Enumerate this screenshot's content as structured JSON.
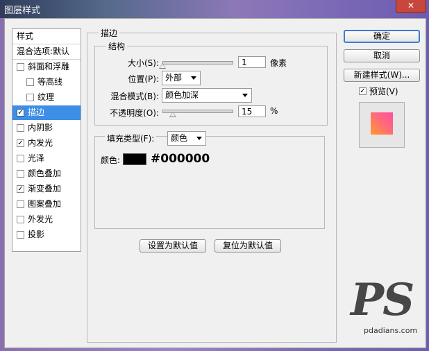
{
  "window": {
    "title": "图层样式",
    "close_glyph": "✕"
  },
  "stylelist": {
    "header": "样式",
    "blending": "混合选项:默认",
    "items": [
      {
        "label": "斜面和浮雕",
        "checked": false,
        "indent": false
      },
      {
        "label": "等高线",
        "checked": false,
        "indent": true
      },
      {
        "label": "纹理",
        "checked": false,
        "indent": true
      },
      {
        "label": "描边",
        "checked": true,
        "indent": false,
        "selected": true
      },
      {
        "label": "内阴影",
        "checked": false,
        "indent": false
      },
      {
        "label": "内发光",
        "checked": true,
        "indent": false
      },
      {
        "label": "光泽",
        "checked": false,
        "indent": false
      },
      {
        "label": "颜色叠加",
        "checked": false,
        "indent": false
      },
      {
        "label": "渐变叠加",
        "checked": true,
        "indent": false
      },
      {
        "label": "图案叠加",
        "checked": false,
        "indent": false
      },
      {
        "label": "外发光",
        "checked": false,
        "indent": false
      },
      {
        "label": "投影",
        "checked": false,
        "indent": false
      }
    ]
  },
  "stroke": {
    "title": "描边",
    "structure": {
      "title": "结构",
      "size_label": "大小(S):",
      "size_value": "1",
      "size_unit": "像素",
      "size_fraction": 0.0,
      "position_label": "位置(P):",
      "position_value": "外部",
      "blend_label": "混合模式(B):",
      "blend_value": "颜色加深",
      "opacity_label": "不透明度(O):",
      "opacity_value": "15",
      "opacity_unit": "%",
      "opacity_fraction": 0.15
    },
    "fill": {
      "type_label": "填充类型(F):",
      "type_value": "颜色",
      "color_label": "颜色:",
      "color_hex": "#000000"
    },
    "set_default": "设置为默认值",
    "reset_default": "复位为默认值"
  },
  "buttons": {
    "ok": "确定",
    "cancel": "取消",
    "new_style": "新建样式(W)...",
    "preview_label": "预览(V)",
    "preview_checked": true
  },
  "watermark": {
    "logo": "PS",
    "url": "pdadians.com"
  },
  "colors": {
    "selection": "#3d8ee6",
    "default_button_border": "#3b7bd0",
    "swatch": "#000000"
  }
}
